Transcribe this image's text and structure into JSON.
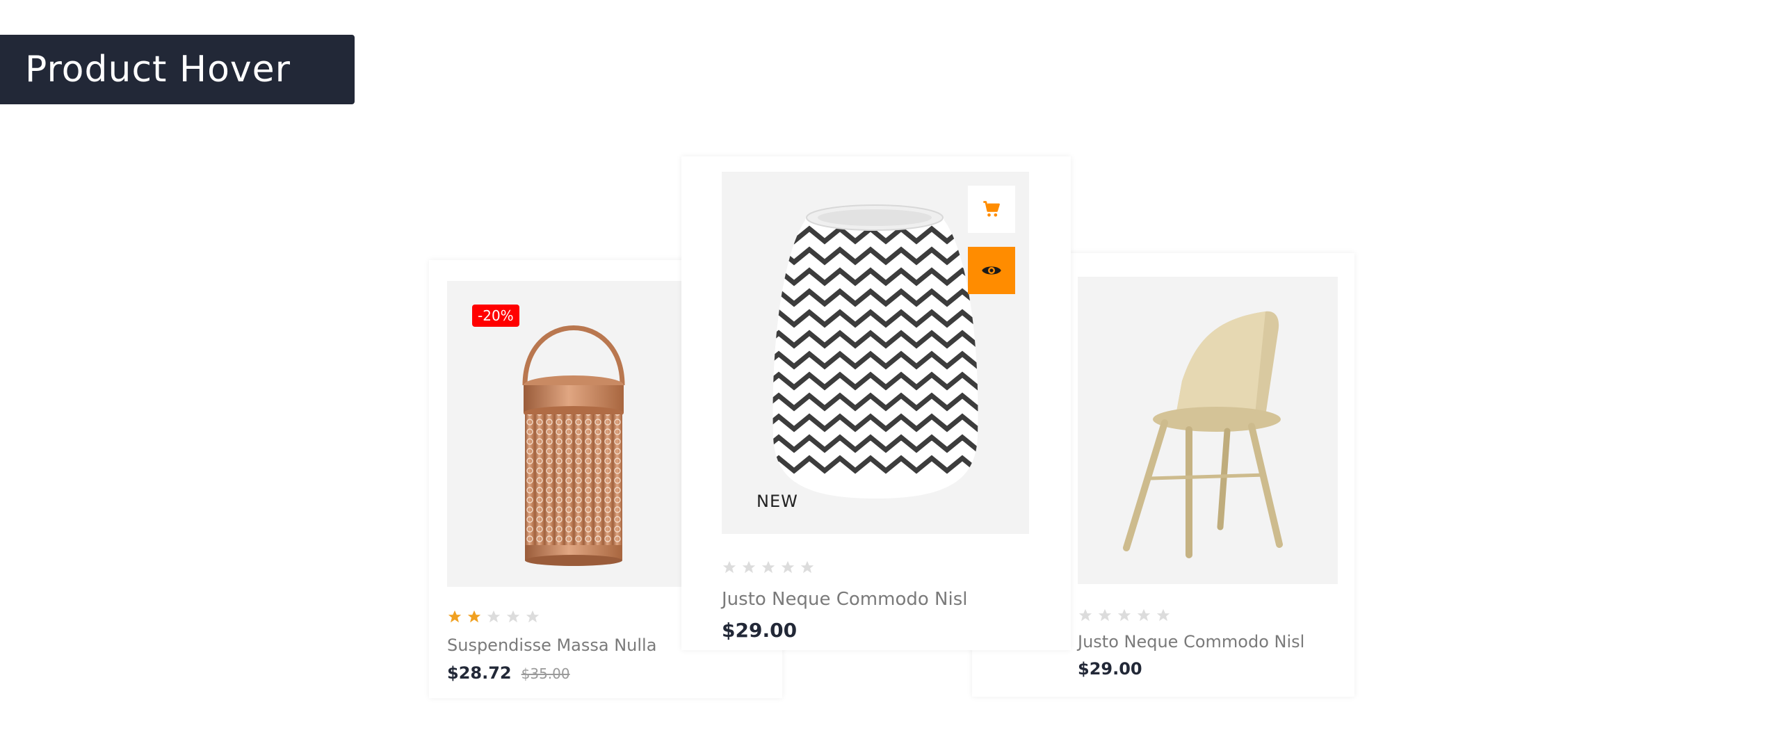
{
  "header": {
    "title": "Product Hover"
  },
  "products": [
    {
      "name": "Suspendisse Massa Nulla",
      "price": "$28.72",
      "old_price": "$35.00",
      "badge": "-20%",
      "rating": 2,
      "rating_max": 5
    },
    {
      "name": "Justo Neque Commodo Nisl",
      "price": "$29.00",
      "badge": "NEW",
      "rating": 0,
      "rating_max": 5,
      "actions": {
        "cart_icon": "cart-icon",
        "quick_view_icon": "eye-icon"
      }
    },
    {
      "name": "Justo Neque Commodo Nisl",
      "price": "$29.00",
      "rating": 0,
      "rating_max": 5
    }
  ],
  "colors": {
    "accent": "#ff8c00",
    "sale_badge": "#ff0000",
    "title_bar": "#222837",
    "star_filled": "#f0a020",
    "star_empty": "#dcdcdc"
  }
}
